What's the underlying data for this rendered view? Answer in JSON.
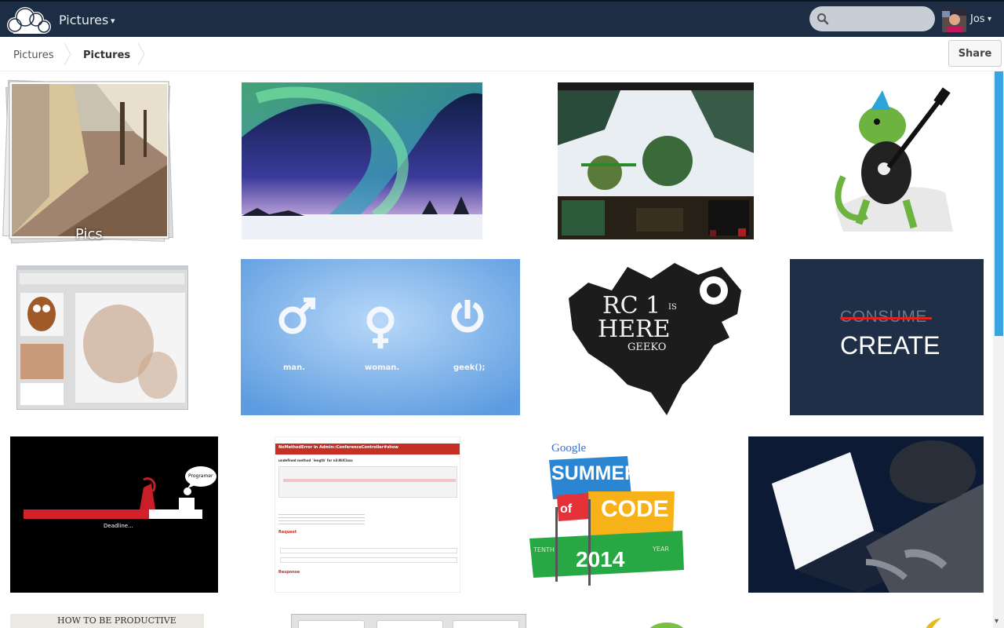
{
  "app": {
    "name": "Pictures",
    "caret": "▾"
  },
  "search": {
    "placeholder": "",
    "value": ""
  },
  "user": {
    "name": "Jos",
    "caret": "▾"
  },
  "breadcrumbs": [
    "Pictures",
    "Pictures"
  ],
  "share_label": "Share",
  "album": {
    "label": "Pics"
  },
  "tiles": {
    "gender": {
      "man": "man.",
      "woman": "woman.",
      "geek": "geek();"
    },
    "rc1": {
      "line1": "RC 1",
      "line2": "IS",
      "line3": "HERE",
      "line4": "GEEKO"
    },
    "consume": {
      "crossed": "CONSUME",
      "main": "CREATE"
    },
    "deadline": {
      "bubble": "Programer",
      "caption": "Deadline..."
    },
    "error": {
      "title": "NoMethodError in Admin::ConferenceController#show",
      "subtitle": "undefined method `length' for nil:NilClass",
      "request": "Request",
      "response": "Response"
    },
    "gsoc": {
      "google": "Google",
      "summer": "SUMMER",
      "of": "of",
      "code": "CODE",
      "year": "2014",
      "tenth": "TENTH",
      "yearword": "YEAR"
    },
    "productive": {
      "text": "HOW TO BE PRODUCTIVE"
    }
  },
  "colors": {
    "topbar": "#1d2d44",
    "accent": "#3aa3e3"
  }
}
